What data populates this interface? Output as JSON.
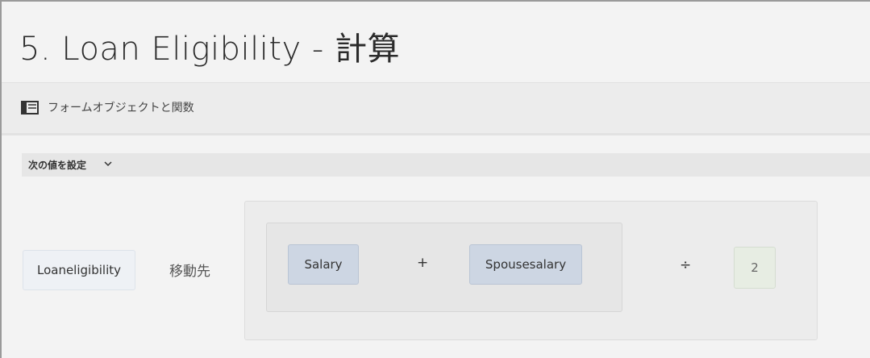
{
  "page": {
    "title": "5. Loan Eligibility - 計算"
  },
  "toolbar": {
    "icon": "form-panel-icon",
    "label": "フォームオブジェクトと関数"
  },
  "section": {
    "label": "次の値を設定",
    "icon": "chevron-down-icon"
  },
  "assignment": {
    "target": "Loaneligibility",
    "goto_label": "移動先",
    "expression": {
      "operand1": "Salary",
      "operator1": "+",
      "operand2": "Spousesalary",
      "operator2": "÷",
      "operand3": "2"
    }
  },
  "colors": {
    "field_chip": "#cdd6e3",
    "number_chip": "#e7ede3",
    "target_chip": "#eef1f5"
  }
}
